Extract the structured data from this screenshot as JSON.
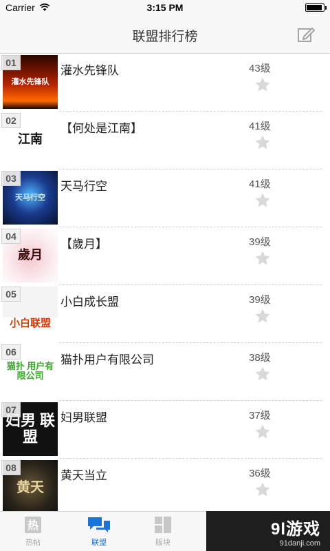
{
  "status": {
    "carrier": "Carrier",
    "time": "3:15 PM"
  },
  "nav": {
    "title": "联盟排行榜",
    "edit_icon": "edit-icon"
  },
  "rows": [
    {
      "rank": "01",
      "name": "灌水先锋队",
      "level": "43级",
      "logo_text": "灌水先锋队"
    },
    {
      "rank": "02",
      "name": "【何处是江南】",
      "level": "41级",
      "logo_text": "江南"
    },
    {
      "rank": "03",
      "name": "天马行空",
      "level": "41级",
      "logo_text": "天马行空"
    },
    {
      "rank": "04",
      "name": "【歲月】",
      "level": "39级",
      "logo_text": "歲月"
    },
    {
      "rank": "05",
      "name": "小白成长盟",
      "level": "39级",
      "logo_text": "小白联盟"
    },
    {
      "rank": "06",
      "name": "猫扑用户有限公司",
      "level": "38级",
      "logo_text": "猫扑 用户有限公司"
    },
    {
      "rank": "07",
      "name": "妇男联盟",
      "level": "37级",
      "logo_text": "妇男 联盟"
    },
    {
      "rank": "08",
      "name": "黄天当立",
      "level": "36级",
      "logo_text": "黄天"
    }
  ],
  "tabs": [
    {
      "label": "热帖",
      "icon": "hot-posts-icon"
    },
    {
      "label": "联盟",
      "icon": "alliance-chat-icon"
    },
    {
      "label": "版块",
      "icon": "sections-icon"
    }
  ],
  "watermark": {
    "main": "9l游戏",
    "sub": "91danji.com"
  },
  "colors": {
    "accent": "#1a73d9",
    "bar": "#f7f7f7"
  }
}
